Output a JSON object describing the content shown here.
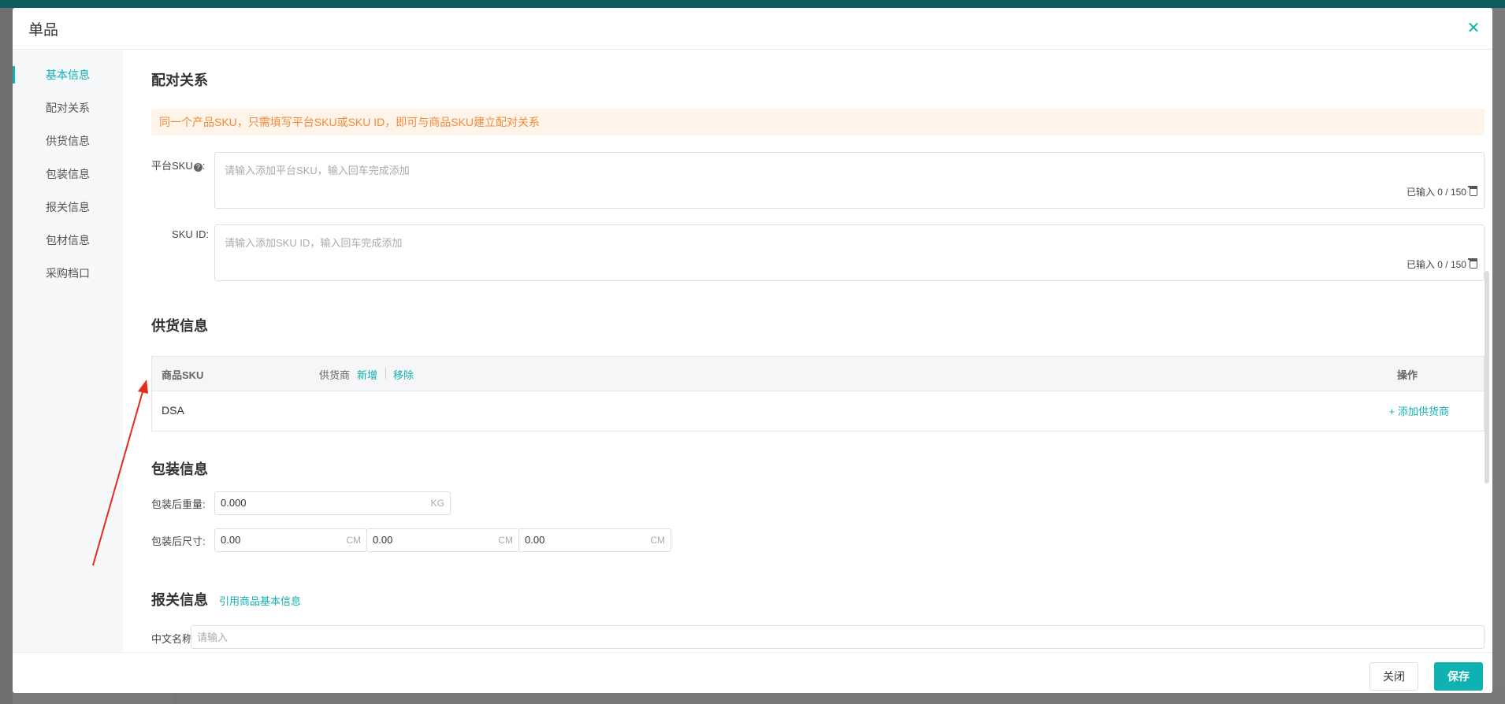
{
  "modal": {
    "title": "单品",
    "close_icon": "close-icon"
  },
  "nav": {
    "items": [
      {
        "label": "基本信息",
        "active": true
      },
      {
        "label": "配对关系"
      },
      {
        "label": "供货信息"
      },
      {
        "label": "包装信息"
      },
      {
        "label": "报关信息"
      },
      {
        "label": "包材信息"
      },
      {
        "label": "采购档口"
      }
    ]
  },
  "pairing": {
    "title": "配对关系",
    "alert": "同一个产品SKU，只需填写平台SKU或SKU ID，即可与商品SKU建立配对关系",
    "platform_sku": {
      "label": "平台SKU",
      "placeholder": "请输入添加平台SKU，输入回车完成添加",
      "counter": "已输入 0 / 150"
    },
    "sku_id": {
      "label": "SKU ID:",
      "placeholder": "请输入添加SKU ID，输入回车完成添加",
      "counter": "已输入 0 / 150"
    }
  },
  "supply": {
    "title": "供货信息",
    "col_sku": "商品SKU",
    "col_supplier": "供货商",
    "add": "新增",
    "remove": "移除",
    "col_op": "操作",
    "rows": [
      {
        "sku": "DSA",
        "action": "+ 添加供货商"
      }
    ]
  },
  "packaging": {
    "title": "包装信息",
    "weight_label": "包装后重量:",
    "weight_value": "0.000",
    "weight_unit": "KG",
    "size_label": "包装后尺寸:",
    "sizes": [
      {
        "value": "0.00",
        "unit": "CM"
      },
      {
        "value": "0.00",
        "unit": "CM"
      },
      {
        "value": "0.00",
        "unit": "CM"
      }
    ]
  },
  "customs": {
    "title": "报关信息",
    "quote_link": "引用商品基本信息",
    "cn_name_label": "中文名称:",
    "cn_name_placeholder": "请输入"
  },
  "footer": {
    "close_label": "关闭",
    "save_label": "保存"
  },
  "colors": {
    "accent": "#0fb1b1",
    "alert_text": "#f08a3c",
    "alert_bg": "#fff4ea",
    "annotation_arrow": "#e8291c"
  }
}
